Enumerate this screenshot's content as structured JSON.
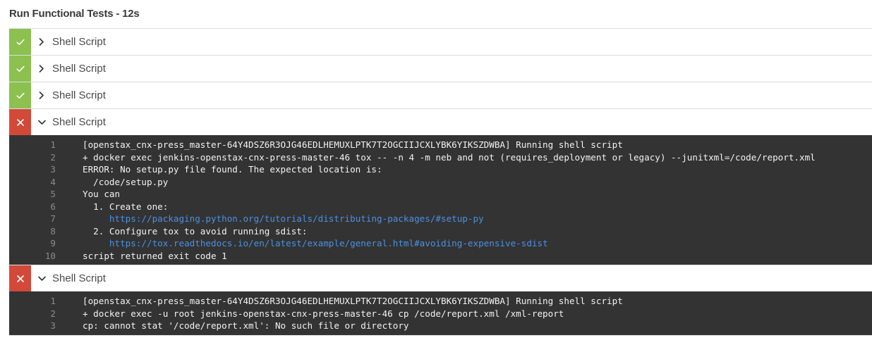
{
  "stage": {
    "title": "Run Functional Tests - 12s"
  },
  "colors": {
    "success": "#8cc04f",
    "failure": "#d24939",
    "log_bg": "#333333",
    "link": "#4a90e2"
  },
  "steps": [
    {
      "label": "Shell Script",
      "status": "success",
      "expanded": false
    },
    {
      "label": "Shell Script",
      "status": "success",
      "expanded": false
    },
    {
      "label": "Shell Script",
      "status": "success",
      "expanded": false
    },
    {
      "label": "Shell Script",
      "status": "failure",
      "expanded": true,
      "log": [
        {
          "n": "1",
          "text": "[openstax_cnx-press_master-64Y4DSZ6R3OJG46EDLHEMUXLPTK7T2OGCIIJCXLYBK6YIKSZDWBA] Running shell script"
        },
        {
          "n": "2",
          "text": "+ docker exec jenkins-openstax-cnx-press-master-46 tox -- -n 4 -m neb and not (requires_deployment or legacy) --junitxml=/code/report.xml"
        },
        {
          "n": "3",
          "text": "ERROR: No setup.py file found. The expected location is:"
        },
        {
          "n": "4",
          "text": "  /code/setup.py"
        },
        {
          "n": "5",
          "text": "You can"
        },
        {
          "n": "6",
          "text": "  1. Create one:"
        },
        {
          "n": "7",
          "indent": "     ",
          "link": "https://packaging.python.org/tutorials/distributing-packages/#setup-py"
        },
        {
          "n": "8",
          "text": "  2. Configure tox to avoid running sdist:"
        },
        {
          "n": "9",
          "indent": "     ",
          "link": "https://tox.readthedocs.io/en/latest/example/general.html#avoiding-expensive-sdist"
        },
        {
          "n": "10",
          "text": "script returned exit code 1"
        }
      ]
    },
    {
      "label": "Shell Script",
      "status": "failure",
      "expanded": true,
      "log": [
        {
          "n": "1",
          "text": "[openstax_cnx-press_master-64Y4DSZ6R3OJG46EDLHEMUXLPTK7T2OGCIIJCXLYBK6YIKSZDWBA] Running shell script"
        },
        {
          "n": "2",
          "text": "+ docker exec -u root jenkins-openstax-cnx-press-master-46 cp /code/report.xml /xml-report"
        },
        {
          "n": "3",
          "text": "cp: cannot stat '/code/report.xml': No such file or directory"
        }
      ]
    }
  ]
}
